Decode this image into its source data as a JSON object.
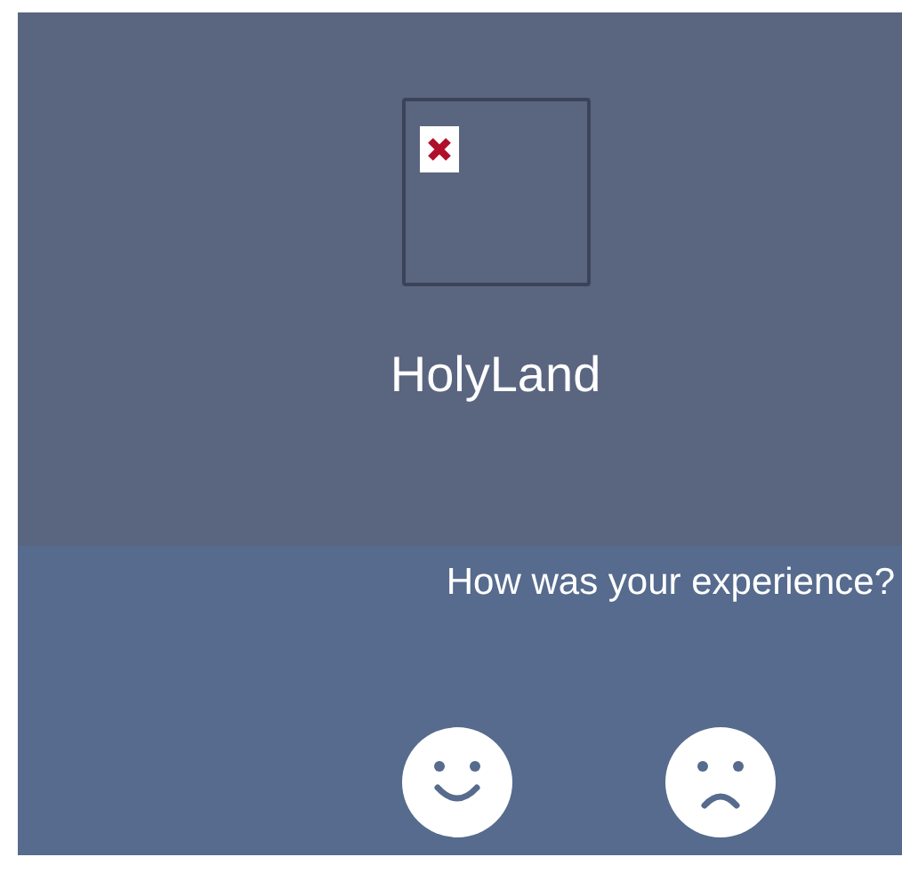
{
  "tile": {
    "image": {
      "kind": "broken"
    },
    "title": "HolyLand"
  },
  "feedback": {
    "prompt": "How was your experience?",
    "options": [
      {
        "kind": "happy"
      },
      {
        "kind": "sad"
      }
    ]
  }
}
